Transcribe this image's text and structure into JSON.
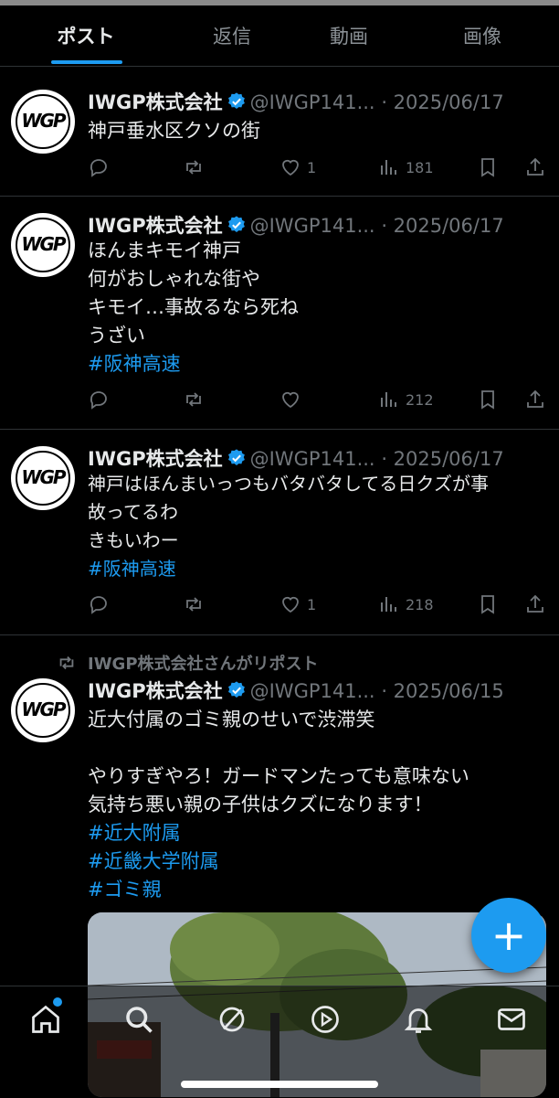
{
  "tabs": [
    "ポスト",
    "返信",
    "動画",
    "画像"
  ],
  "avatar_text": "WGP",
  "tweets": [
    {
      "name": "IWGP株式会社",
      "handle": "@IWGP141...",
      "date": "· 2025/06/17",
      "lines": [
        "神戸垂水区クソの街"
      ],
      "counts": {
        "reply": "",
        "repost": "",
        "like": "1",
        "views": "181"
      }
    },
    {
      "name": "IWGP株式会社",
      "handle": "@IWGP141...",
      "date": "· 2025/06/17",
      "lines": [
        "ほんまキモイ神戸",
        "何がおしゃれな街や",
        "キモイ…事故るなら死ね",
        "うざい"
      ],
      "hashtags": [
        "#阪神高速"
      ],
      "counts": {
        "reply": "",
        "repost": "",
        "like": "",
        "views": "212"
      }
    },
    {
      "name": "IWGP株式会社",
      "handle": "@IWGP141...",
      "date": "· 2025/06/17",
      "lines": [
        "神戸はほんまいっつもバタバタしてる日クズが事",
        "故ってるわ",
        "きもいわー"
      ],
      "hashtags": [
        "#阪神高速"
      ],
      "counts": {
        "reply": "",
        "repost": "",
        "like": "1",
        "views": "218"
      }
    },
    {
      "repost_label": "IWGP株式会社さんがリポスト",
      "name": "IWGP株式会社",
      "handle": "@IWGP141...",
      "date": "· 2025/06/15",
      "lines": [
        "近大付属のゴミ親のせいで渋滞笑",
        "",
        "やりすぎやろ！ガードマンたっても意味ない",
        "気持ち悪い親の子供はクズになります！"
      ],
      "hashtags": [
        "#近大附属",
        "#近畿大学附属",
        "#ゴミ親"
      ]
    }
  ],
  "fab_label": "+",
  "colors": {
    "accent": "#1d9bf0",
    "muted": "#71767b",
    "text": "#e7e9ea",
    "divider": "#2f3336"
  },
  "nav": [
    "home-icon",
    "search-icon",
    "grok-icon",
    "video-icon",
    "notifications-icon",
    "messages-icon"
  ]
}
